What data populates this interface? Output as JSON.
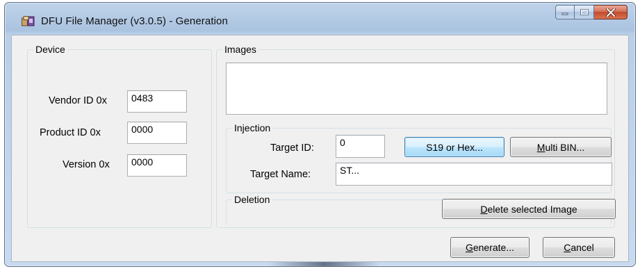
{
  "window": {
    "title": "DFU File Manager (v3.0.5) - Generation"
  },
  "device": {
    "group_label": "Device",
    "vendor_label": "Vendor ID 0x",
    "vendor_value": "0483",
    "product_label": "Product ID 0x",
    "product_value": "0000",
    "version_label": "Version 0x",
    "version_value": "0000"
  },
  "images": {
    "group_label": "Images"
  },
  "injection": {
    "group_label": "Injection",
    "target_id_label": "Target ID:",
    "target_id_value": "0",
    "target_name_label": "Target Name:",
    "target_name_value": "ST...",
    "s19_button": "S19 or Hex...",
    "multibin_mnemonic": "M",
    "multibin_rest": "ulti BIN..."
  },
  "deletion": {
    "group_label": "Deletion",
    "delete_mnemonic": "D",
    "delete_rest": "elete selected Image"
  },
  "footer": {
    "generate_mnemonic": "G",
    "generate_rest": "enerate...",
    "cancel_mnemonic": "C",
    "cancel_rest": "ancel"
  },
  "colors": {
    "close_button": "#c24a2c",
    "focus_button": "#3c7fb1",
    "frame": "#aac3e0"
  }
}
